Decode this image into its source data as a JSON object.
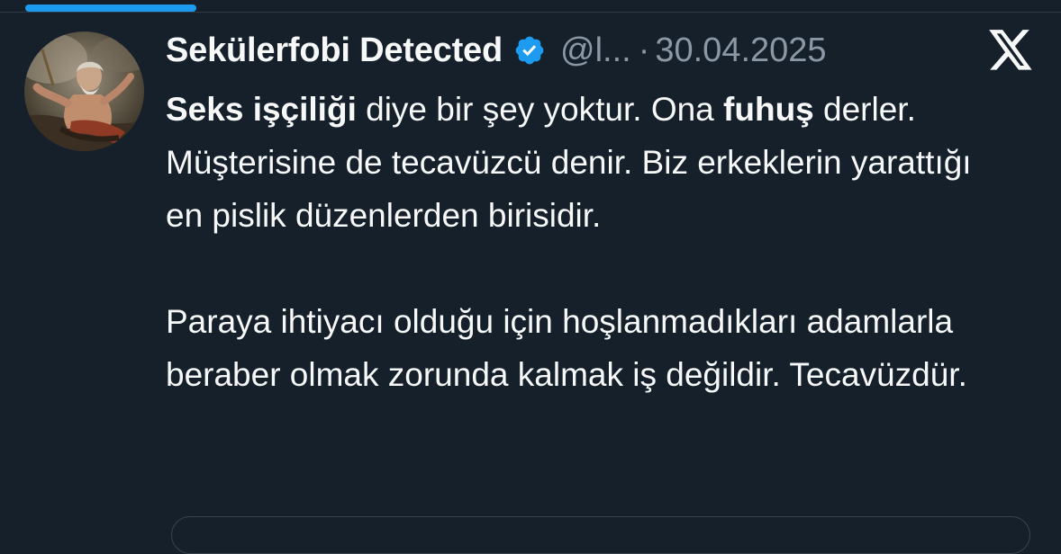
{
  "colors": {
    "background": "#15202b",
    "accent": "#1d9bf0",
    "text_primary": "#f7f9f9",
    "text_secondary": "#8b98a5"
  },
  "tweet": {
    "author": {
      "display_name": "Sekülerfobi Detected",
      "handle": "@l...",
      "verified": true,
      "verified_icon": "verified-badge-icon"
    },
    "separator": "·",
    "date": "30.04.2025",
    "brand_icon": "x-logo-icon",
    "body": {
      "p1": {
        "s1_bold": "Seks işçiliği",
        "s2": " diye bir şey yoktur. Ona ",
        "s3_bold": "fuhuş",
        "s4": " derler. Müşterisine de tecavüzcü denir. Biz erkeklerin yarattığı en pislik düzenlerden birisidir."
      },
      "p2": "Paraya ihtiyacı olduğu için hoşlanmadıkları adamlarla beraber olmak zorunda kalmak iş değildir. Tecavüzdür."
    }
  }
}
